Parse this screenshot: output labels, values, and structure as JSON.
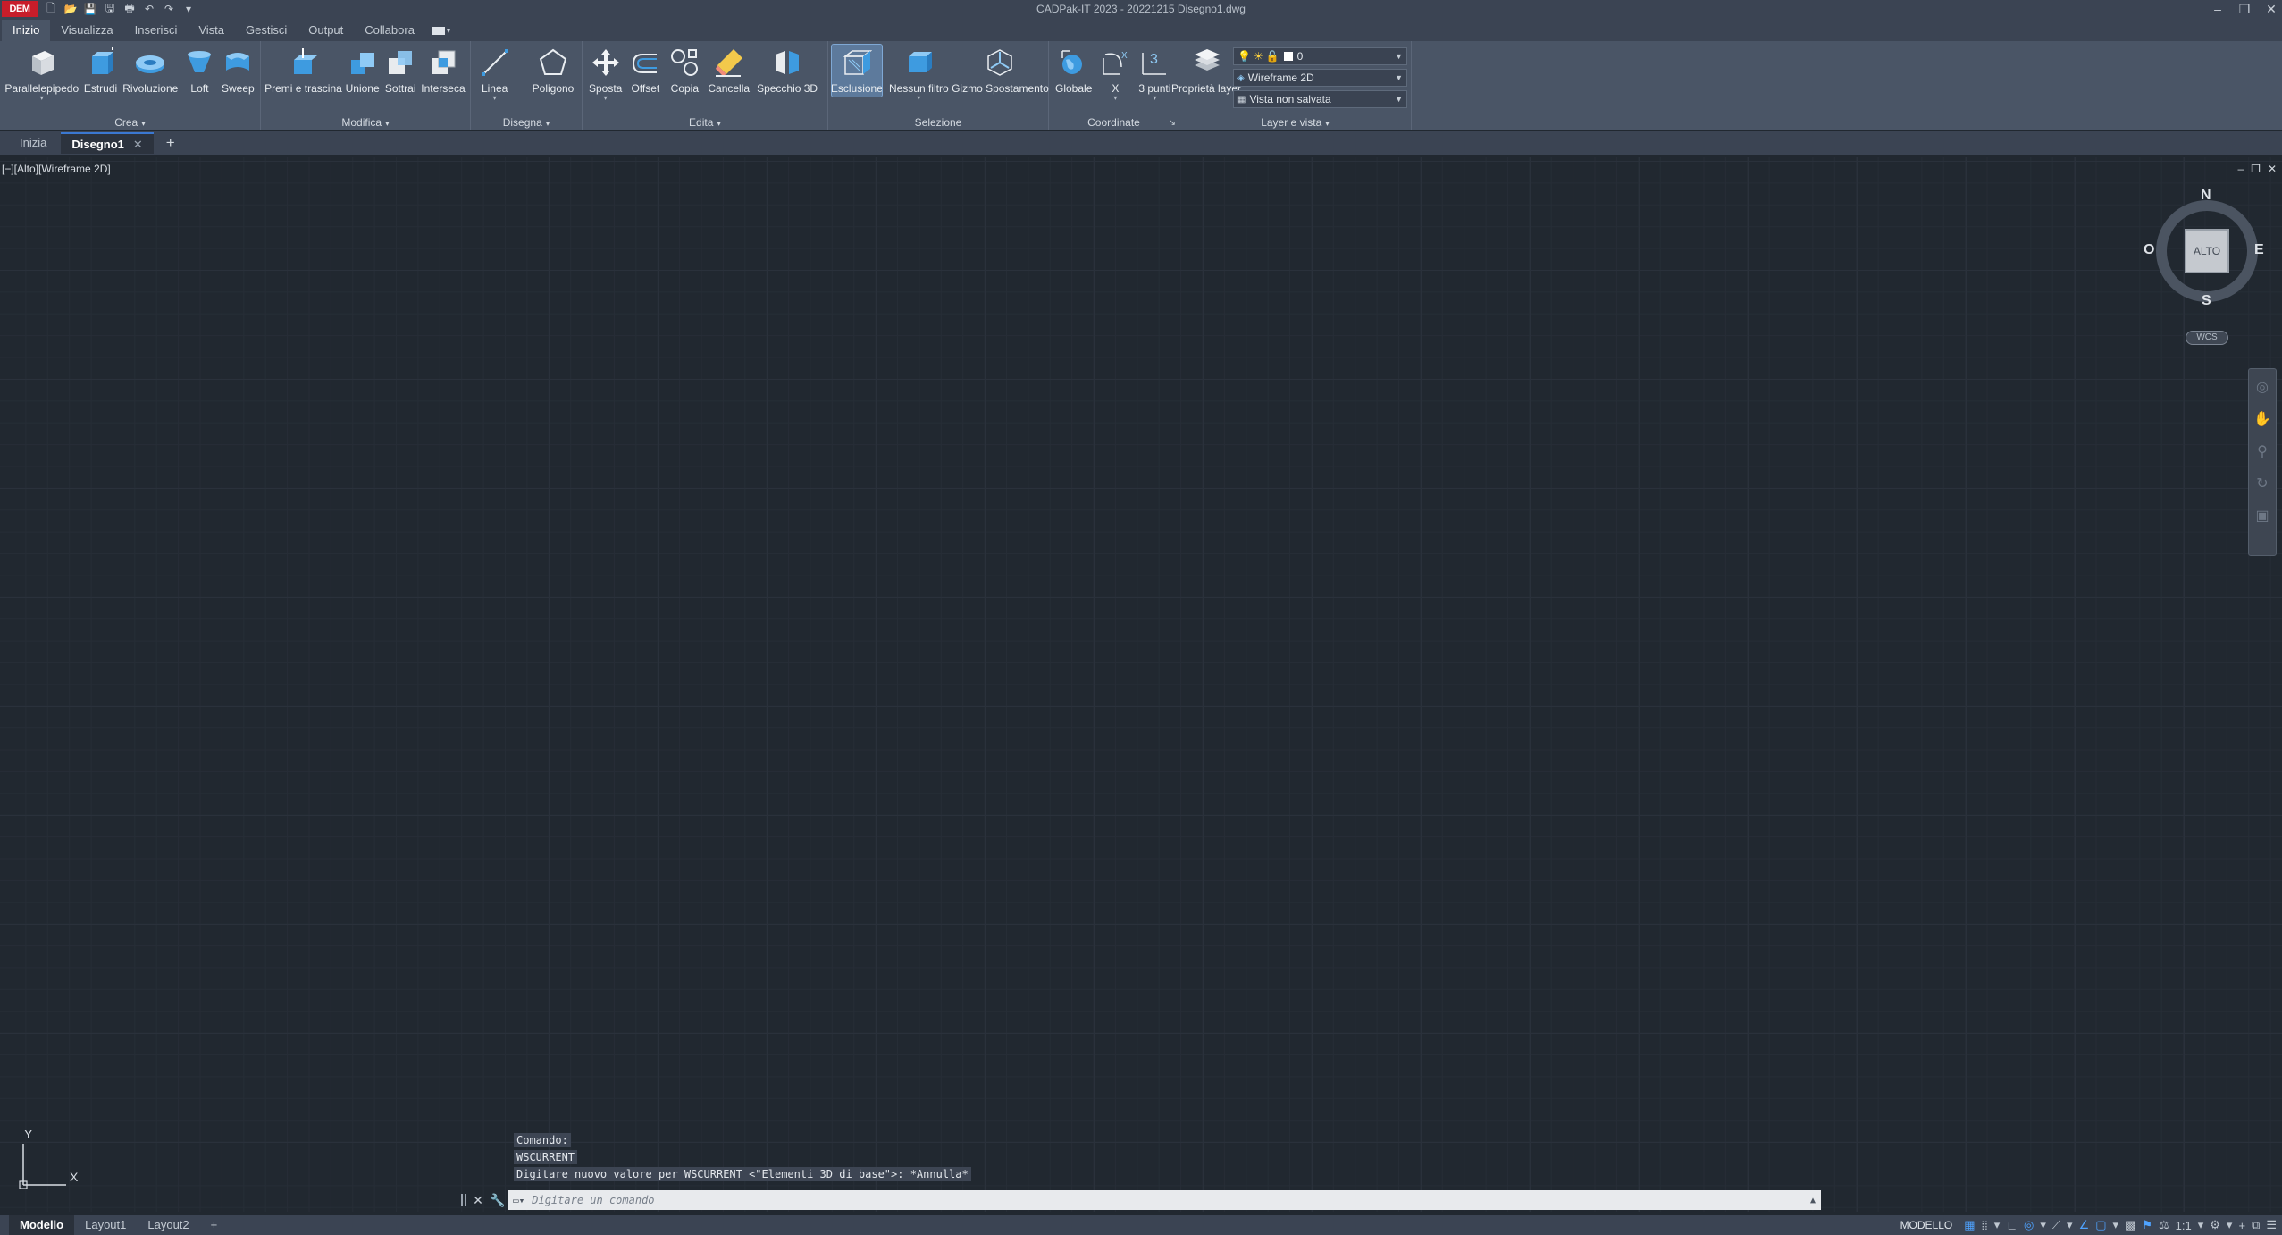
{
  "title_bar": {
    "logo": "DEM",
    "title": "CADPak-IT 2023 - 20221215   Disegno1.dwg"
  },
  "menu": {
    "tabs": [
      "Inizio",
      "Visualizza",
      "Inserisci",
      "Vista",
      "Gestisci",
      "Output",
      "Collabora"
    ],
    "active": "Inizio"
  },
  "ribbon": {
    "crea": {
      "footer": "Crea",
      "tools": [
        "Parallelepipedo",
        "Estrudi",
        "Rivoluzione",
        "Loft",
        "Sweep"
      ]
    },
    "modifica": {
      "footer": "Modifica",
      "tools": [
        "Premi e trascina",
        "Unione",
        "Sottrai",
        "Interseca"
      ]
    },
    "disegna": {
      "footer": "Disegna",
      "tools": [
        "Linea",
        "Poligono"
      ]
    },
    "edita": {
      "footer": "Edita",
      "tools": [
        "Sposta",
        "Offset",
        "Copia",
        "Cancella",
        "Specchio 3D"
      ]
    },
    "selezione": {
      "footer": "Selezione",
      "tools": [
        "Esclusione",
        "Nessun filtro",
        "Gizmo Spostamento"
      ]
    },
    "coordinate": {
      "footer": "Coordinate",
      "tools": [
        "Globale",
        "X",
        "3 punti"
      ]
    },
    "layer": {
      "footer": "Layer e vista",
      "tool": "Proprietà layer",
      "layer_value": "0",
      "visual_style": "Wireframe 2D",
      "view": "Vista non salvata"
    }
  },
  "doc_tabs": {
    "start": "Inizia",
    "active": "Disegno1"
  },
  "viewport": {
    "label": "[−][Alto][Wireframe 2D]",
    "viewcube": {
      "face": "ALTO",
      "n": "N",
      "s": "S",
      "e": "E",
      "w": "O",
      "wcs": "WCS"
    }
  },
  "command": {
    "history": [
      "Comando:",
      "WSCURRENT",
      "Digitare nuovo valore per WSCURRENT <\"Elementi 3D di base\">: *Annulla*"
    ],
    "placeholder": "Digitare un comando"
  },
  "status": {
    "layout_tabs": [
      "Modello",
      "Layout1",
      "Layout2"
    ],
    "active_tab": "Modello",
    "space": "MODELLO",
    "scale": "1:1"
  },
  "colors": {
    "accent": "#3b78d1",
    "background": "#212830",
    "ribbon": "#4a5566",
    "logo_red": "#c81d2a"
  }
}
